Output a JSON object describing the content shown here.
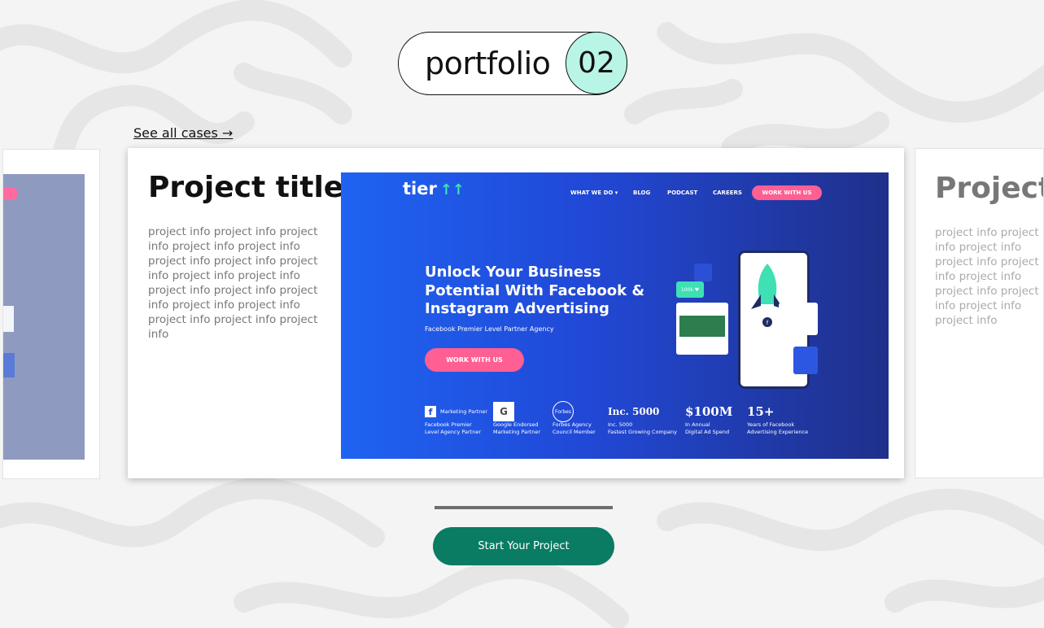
{
  "header": {
    "label": "portfolio",
    "number": "02"
  },
  "see_all": "See all  cases →",
  "main_card": {
    "title": "Project title",
    "info": "project info project info project info project info project info project info project info project info project info project info project info project info project info project info project info project info project info project info"
  },
  "right_card": {
    "title": "Project title",
    "info": "project info project info project info project info project info project info project info project info project info project info"
  },
  "screenshot": {
    "logo": "tier",
    "logo_mark": "↑↑",
    "nav": [
      "WHAT WE DO ▾",
      "BLOG",
      "PODCAST",
      "CAREERS"
    ],
    "nav_button": "WORK WITH US",
    "hero_title": "Unlock Your Business Potential With Facebook & Instagram Advertising",
    "hero_subtitle": "Facebook Premier Level Partner Agency",
    "hero_button": "WORK WITH US",
    "bubble": "100k ♥",
    "badges": [
      {
        "head": "Marketing Partner",
        "lines": [
          "Facebook Premier",
          "Level Agency Partner"
        ]
      },
      {
        "head": "G",
        "lines": [
          "Google Endorsed",
          "Marketing Partner"
        ]
      },
      {
        "head": "Forbes",
        "lines": [
          "Forbes Agency",
          "Council Member"
        ]
      },
      {
        "head": "Inc. 5000",
        "lines": [
          "Inc. 5000",
          "Fastest Growing Company"
        ]
      },
      {
        "head": "$100M",
        "lines": [
          "In Annual",
          "Digital Ad Spend"
        ]
      },
      {
        "head": "15+",
        "lines": [
          "Years of Facebook",
          "Advertising Experience"
        ]
      }
    ]
  },
  "slider": {
    "progress": 1.0
  },
  "cta": "Start Your Project",
  "colors": {
    "accent_mint": "#b9f5e6",
    "cta_green": "#0a7c63",
    "pink": "#ff5f93",
    "hero_blue": "#1f63f2"
  }
}
